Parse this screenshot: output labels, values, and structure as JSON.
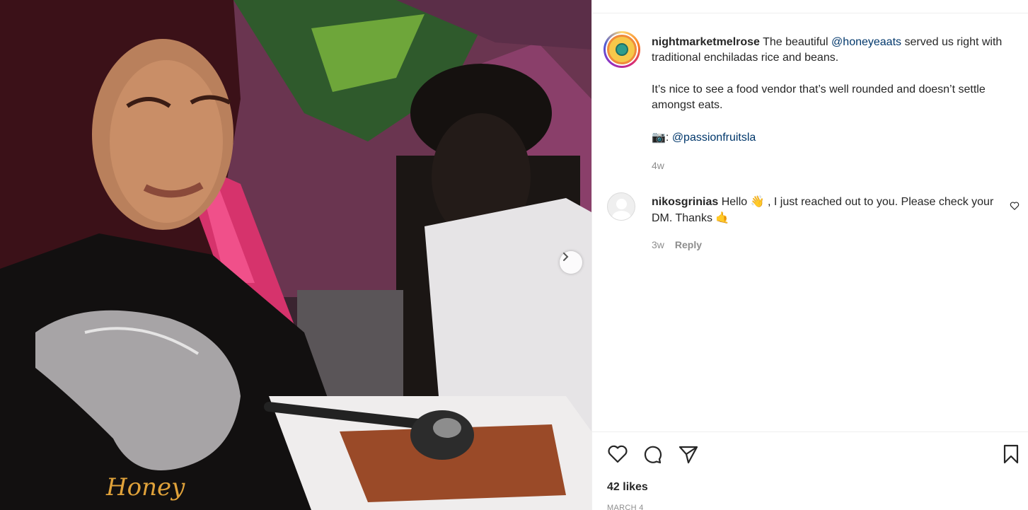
{
  "post": {
    "username": "nightmarketmelrose",
    "caption_part1": " The beautiful ",
    "mention_honey": "@honeyeaats",
    "caption_part2": " served us right with traditional enchiladas rice and beans.",
    "caption_para2": "It’s nice to see a food vendor that’s well rounded and doesn’t settle amongst eats.",
    "camera_emoji": "📷",
    "credit_prefix": ": ",
    "mention_photo": "@passionfruitsla",
    "posted_ago": "4w",
    "avatar_icon": "globe-logo-icon"
  },
  "comment": {
    "username": "nikosgrinias",
    "text_part1": " Hello ",
    "wave_emoji": "👋",
    "text_part2": " , I just reached out to you. Please check your DM. Thanks ",
    "hands_emoji": "🤙",
    "time": "3w",
    "reply_label": "Reply"
  },
  "footer": {
    "likes": "42 likes",
    "date": "MARCH 4"
  },
  "icons": {
    "like": "heart-icon",
    "comment": "comment-bubble-icon",
    "share": "paper-plane-icon",
    "save": "bookmark-icon",
    "next": "chevron-right-icon"
  },
  "colors": {
    "mention": "#00376b",
    "muted": "#8e8e8e",
    "text": "#262626"
  }
}
